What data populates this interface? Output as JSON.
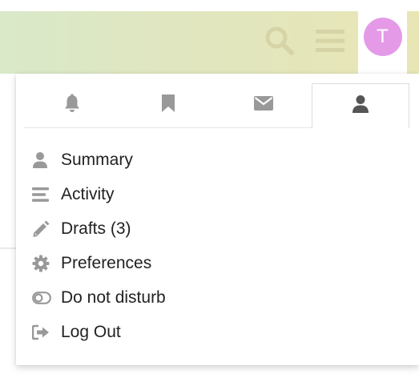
{
  "header": {
    "search_icon": "search-icon",
    "menu_icon": "hamburger-icon",
    "avatar_letter": "T",
    "avatar_color": "#e59ae8"
  },
  "tabs": [
    {
      "icon": "bell-icon",
      "active": false
    },
    {
      "icon": "bookmark-icon",
      "active": false
    },
    {
      "icon": "envelope-icon",
      "active": false
    },
    {
      "icon": "user-icon",
      "active": true
    }
  ],
  "menu": {
    "items": [
      {
        "icon": "user-icon",
        "label": "Summary"
      },
      {
        "icon": "activity-icon",
        "label": "Activity"
      },
      {
        "icon": "pencil-icon",
        "label": "Drafts (3)"
      },
      {
        "icon": "gear-icon",
        "label": "Preferences"
      },
      {
        "icon": "toggle-off-icon",
        "label": "Do not disturb"
      },
      {
        "icon": "sign-out-icon",
        "label": "Log Out"
      }
    ]
  },
  "colors": {
    "icon_gray": "#999999",
    "icon_dark": "#555555",
    "header_icon": "#d8d6ab"
  }
}
